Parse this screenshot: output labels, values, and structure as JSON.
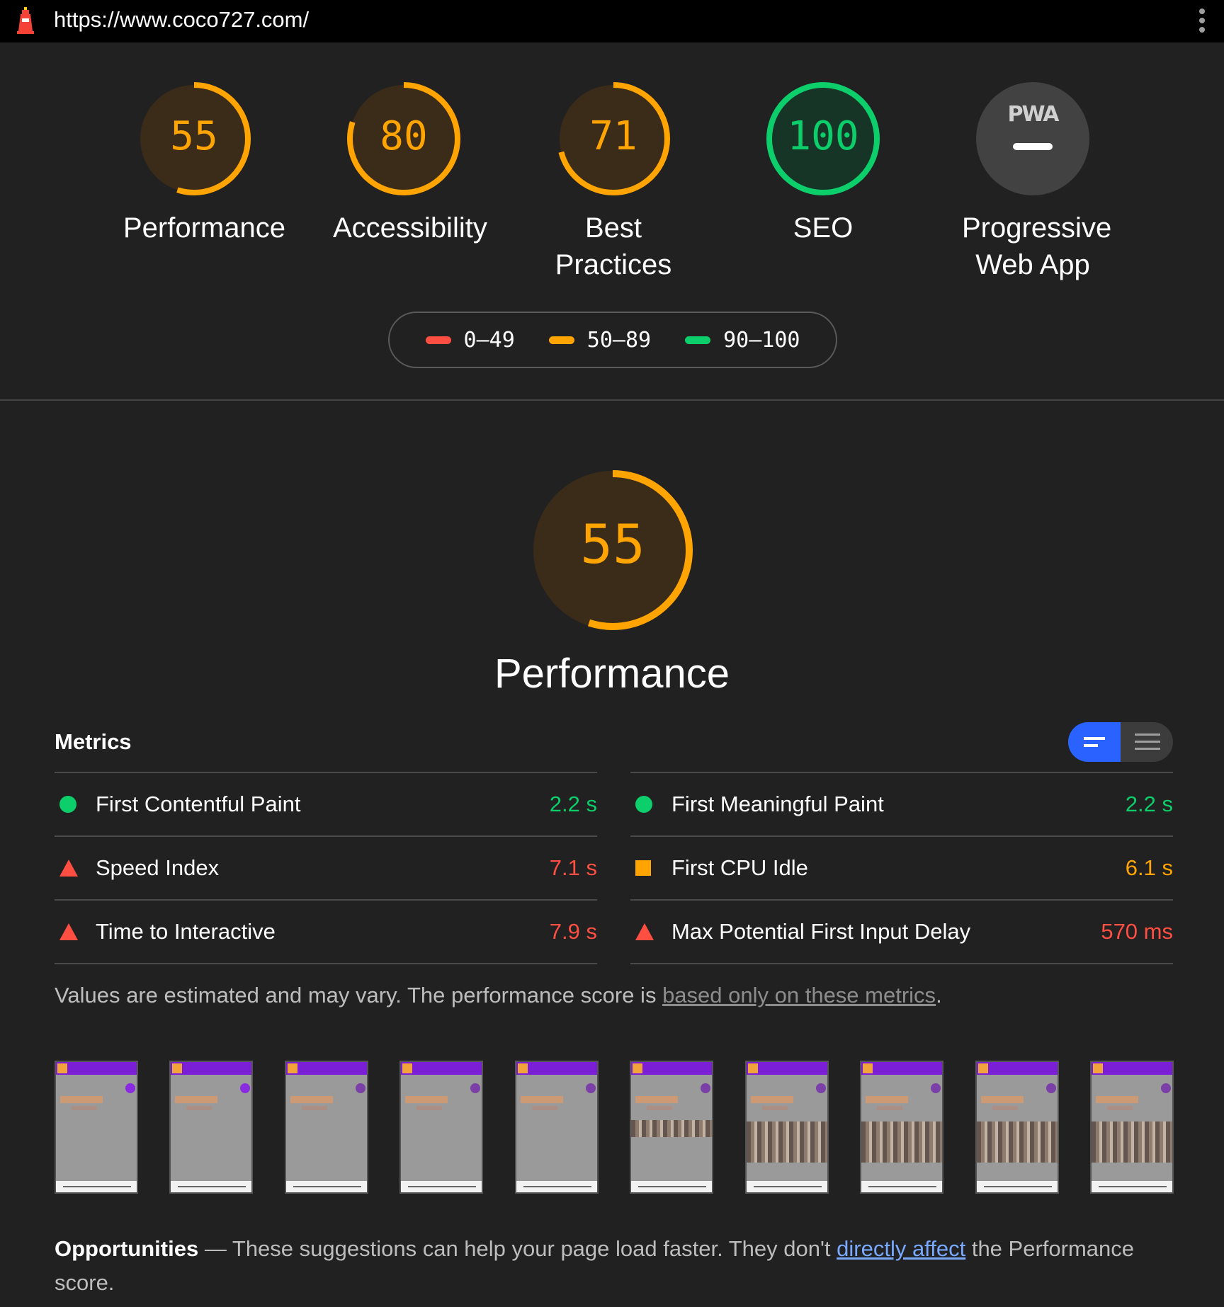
{
  "browser": {
    "url": "https://www.coco727.com/"
  },
  "colors": {
    "pass": "#0cce6b",
    "average": "#ffa400",
    "fail": "#ff4e42",
    "toggle_active": "#2962ff"
  },
  "categories": [
    {
      "label": "Performance",
      "score": "55",
      "score_fraction": 0.55
    },
    {
      "label": "Accessibility",
      "score": "80",
      "score_fraction": 0.8
    },
    {
      "label": "Best Practices",
      "score": "71",
      "score_fraction": 0.71
    },
    {
      "label": "SEO",
      "score": "100",
      "score_fraction": 1.0
    },
    {
      "label_line1": "Progressive",
      "label_line2": "Web App",
      "badge": "PWA"
    }
  ],
  "legend": {
    "fail": "0–49",
    "average": "50–89",
    "pass": "90–100"
  },
  "performance": {
    "score": "55",
    "title": "Performance",
    "metrics_heading": "Metrics",
    "metrics": {
      "fcp": {
        "name": "First Contentful Paint",
        "value": "2.2 s",
        "status": "pass"
      },
      "fmp": {
        "name": "First Meaningful Paint",
        "value": "2.2 s",
        "status": "pass"
      },
      "si": {
        "name": "Speed Index",
        "value": "7.1 s",
        "status": "fail"
      },
      "cpu": {
        "name": "First CPU Idle",
        "value": "6.1 s",
        "status": "average"
      },
      "tti": {
        "name": "Time to Interactive",
        "value": "7.9 s",
        "status": "fail"
      },
      "fid": {
        "name": "Max Potential First Input Delay",
        "value": "570 ms",
        "status": "fail"
      }
    },
    "note_prefix": "Values are estimated and may vary. The performance score is ",
    "note_link": "based only on these metrics",
    "note_suffix": ".",
    "opportunities_title": "Opportunities",
    "opportunities_prefix": " — These suggestions can help your page load faster. They don't ",
    "opportunities_link": "directly affect",
    "opportunities_suffix": " the Performance score."
  }
}
